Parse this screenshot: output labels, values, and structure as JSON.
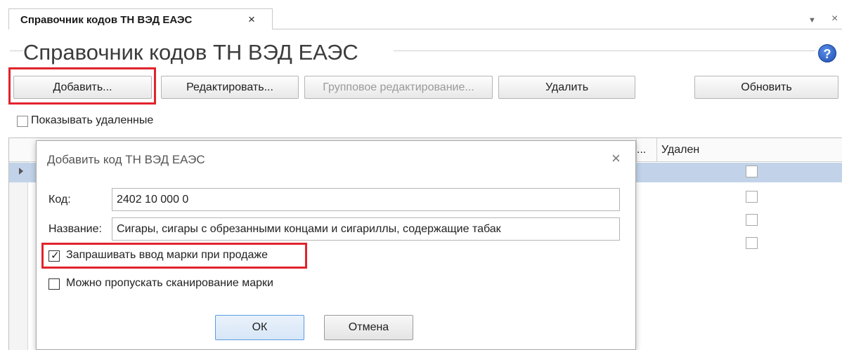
{
  "tab": {
    "label": "Справочник кодов ТН ВЭД ЕАЭС",
    "close": "×"
  },
  "window_controls": {
    "dropdown": "▼",
    "close": "×"
  },
  "page": {
    "title": "Справочник кодов ТН ВЭД ЕАЭС",
    "help": "?"
  },
  "toolbar": {
    "add": "Добавить...",
    "edit": "Редактировать...",
    "group_edit": "Групповое редактирование...",
    "delete": "Удалить",
    "refresh": "Обновить"
  },
  "show_deleted": {
    "label": "Показывать удаленные",
    "checked": false
  },
  "grid": {
    "columns": [
      "...",
      "Удален"
    ],
    "rows": [
      {
        "deleted": false,
        "selected": true
      },
      {
        "deleted": false
      },
      {
        "deleted": false
      },
      {
        "deleted": false
      }
    ]
  },
  "dialog": {
    "title": "Добавить код ТН ВЭД ЕАЭС",
    "close": "×",
    "code_label": "Код:",
    "code_value": "2402 10 000 0",
    "name_label": "Название:",
    "name_value": "Сигары, сигары с обрезанными концами и сигариллы, содержащие табак",
    "require_mark": {
      "label": "Запрашивать ввод марки при продаже",
      "checked": true
    },
    "allow_skip": {
      "label": "Можно пропускать сканирование марки",
      "checked": false
    },
    "ok": "ОК",
    "cancel": "Отмена"
  },
  "colors": {
    "highlight": "#e0242c",
    "selected_row": "#c2d3e9",
    "default_button": "#5b9be0"
  }
}
